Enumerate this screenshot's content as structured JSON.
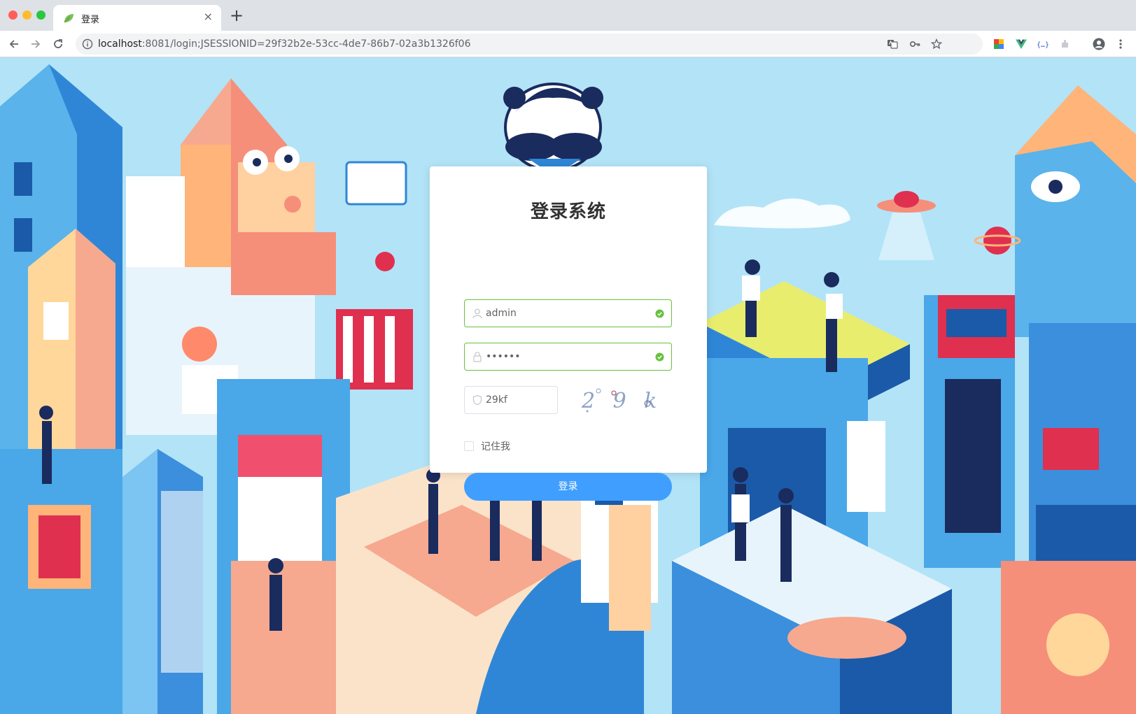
{
  "browser": {
    "tab": {
      "title": "登录",
      "close_glyph": "×"
    },
    "new_tab_glyph": "+",
    "url_host": "localhost",
    "url_rest": ":8081/login;JSESSIONID=29f32b2e-53cc-4de7-86b7-02a3b1326f06",
    "icons": [
      "back-arrow-icon",
      "forward-arrow-icon",
      "reload-icon",
      "info-icon",
      "translate-icon",
      "key-icon",
      "star-icon",
      "profile-icon",
      "menu-dots-icon"
    ]
  },
  "login": {
    "title": "登录系统",
    "username": {
      "value": "admin"
    },
    "password": {
      "value": "••••••"
    },
    "code": {
      "value": "29kf"
    },
    "captcha_text": "2 9 k F",
    "remember_label": "记住我",
    "submit_label": "登录"
  },
  "colors": {
    "primary": "#409eff",
    "success": "#67c23a",
    "sky": "#b3e3f7"
  }
}
